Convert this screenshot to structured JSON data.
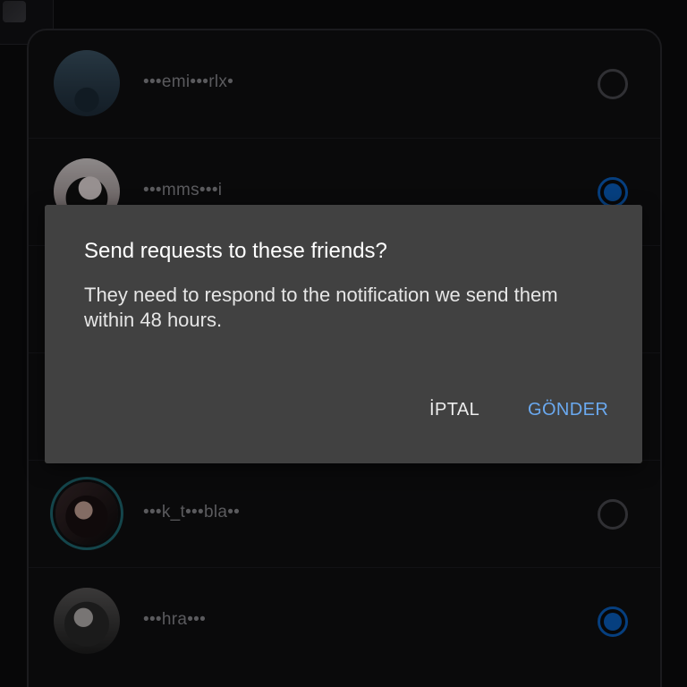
{
  "friends": [
    {
      "username": "•••emi•••rlx•",
      "selected": false,
      "avatar": "avatar-photo"
    },
    {
      "username": "•••mms•••i",
      "selected": true,
      "avatar": "avatar-photo"
    },
    {
      "username": "•••k_t•••bla••",
      "selected": false,
      "avatar": "avatar-photo-story-ring"
    },
    {
      "username": "•••hra•••",
      "selected": true,
      "avatar": "avatar-photo"
    }
  ],
  "dialog": {
    "title": "Send requests to these friends?",
    "body": "They need to respond to the notification we send them within 48 hours.",
    "cancel_label": "İPTAL",
    "send_label": "GÖNDER"
  },
  "colors": {
    "background": "#0b0b0d",
    "dialog_bg": "#414141",
    "accent": "#6aa9f0",
    "radio_selected": "#0a61c4",
    "username_text": "#8a8a90"
  }
}
